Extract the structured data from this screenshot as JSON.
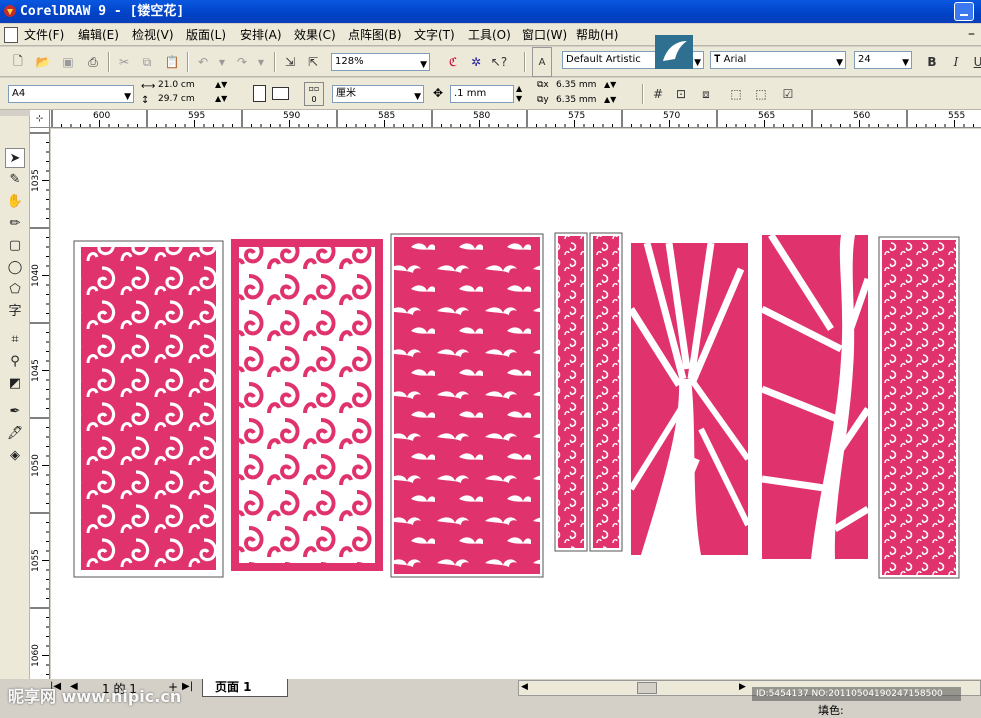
{
  "window": {
    "title": "CorelDRAW 9 - [镂空花]"
  },
  "menu": [
    "文件(F)",
    "编辑(E)",
    "检视(V)",
    "版面(L)",
    "安排(A)",
    "效果(C)",
    "点阵图(B)",
    "文字(T)",
    "工具(O)",
    "窗口(W)",
    "帮助(H)"
  ],
  "toolbar_standard": {
    "zoom": "128%",
    "style": "Default Artistic",
    "font": "Arial",
    "font_size": "24",
    "bold": "B",
    "italic": "I",
    "underline": "U"
  },
  "property_bar": {
    "paper": "A4",
    "width": "21.0 cm",
    "height": "29.7 cm",
    "units": "厘米",
    "nudge": ".1 mm",
    "dup_x": "6.35 mm",
    "dup_y": "6.35 mm"
  },
  "rulers": {
    "horizontal": [
      "600",
      "595",
      "590",
      "585",
      "580",
      "575",
      "570",
      "565",
      "560",
      "555"
    ],
    "vertical": [
      "1035",
      "1040",
      "1045",
      "1050",
      "1055",
      "1060"
    ]
  },
  "colors": {
    "accent": "#e0336e",
    "title_bar": "#0a58e0"
  },
  "status": {
    "page_counter": "1 的 1",
    "page_tab": "页面 1",
    "fill_label": "填色:",
    "watermark_left": "昵享网 www.nipic.cn",
    "watermark_right": "ID:5454137 NO:20110504190247158500"
  }
}
